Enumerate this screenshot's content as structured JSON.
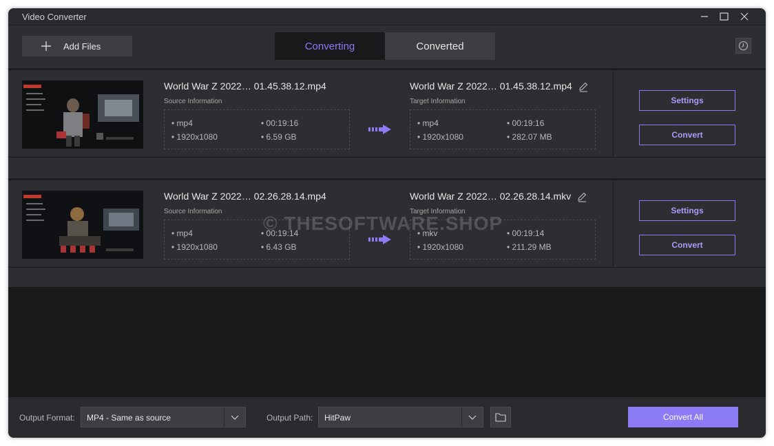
{
  "window": {
    "title": "Video Converter"
  },
  "toolbar": {
    "add_files_label": "Add Files",
    "tabs": [
      {
        "label": "Converting",
        "active": true
      },
      {
        "label": "Converted",
        "active": false
      }
    ]
  },
  "items": [
    {
      "source_name": "World War Z 2022… 01.45.38.12.mp4",
      "source_label": "Source Information",
      "source_format": "• mp4",
      "source_duration": "• 00:19:16",
      "source_resolution": "• 1920x1080",
      "source_size": "• 6.59 GB",
      "target_name": "World War Z 2022… 01.45.38.12.mp4",
      "target_label": "Target Information",
      "target_format": "• mp4",
      "target_duration": "• 00:19:16",
      "target_resolution": "• 1920x1080",
      "target_size": "• 282.07 MB",
      "settings_label": "Settings",
      "convert_label": "Convert"
    },
    {
      "source_name": "World War Z 2022… 02.26.28.14.mp4",
      "source_label": "Source Information",
      "source_format": "• mp4",
      "source_duration": "• 00:19:14",
      "source_resolution": "• 1920x1080",
      "source_size": "• 6.43 GB",
      "target_name": "World War Z 2022… 02.26.28.14.mkv",
      "target_label": "Target Information",
      "target_format": "• mkv",
      "target_duration": "• 00:19:14",
      "target_resolution": "• 1920x1080",
      "target_size": "• 211.29 MB",
      "settings_label": "Settings",
      "convert_label": "Convert"
    }
  ],
  "watermark": "© THESOFTWARE.SHOP",
  "bottom": {
    "output_format_label": "Output Format:",
    "output_format_value": "MP4 - Same as source",
    "output_path_label": "Output Path:",
    "output_path_value": "HitPaw",
    "convert_all_label": "Convert All"
  },
  "colors": {
    "accent": "#8b7cf6",
    "background": "#2d2e31",
    "empty_area": "#1a1b1d"
  },
  "icons": [
    "plus-icon",
    "history-icon",
    "minimize-icon",
    "maximize-icon",
    "close-icon",
    "edit-icon",
    "arrow-right-icon",
    "chevron-down-icon",
    "folder-icon"
  ]
}
